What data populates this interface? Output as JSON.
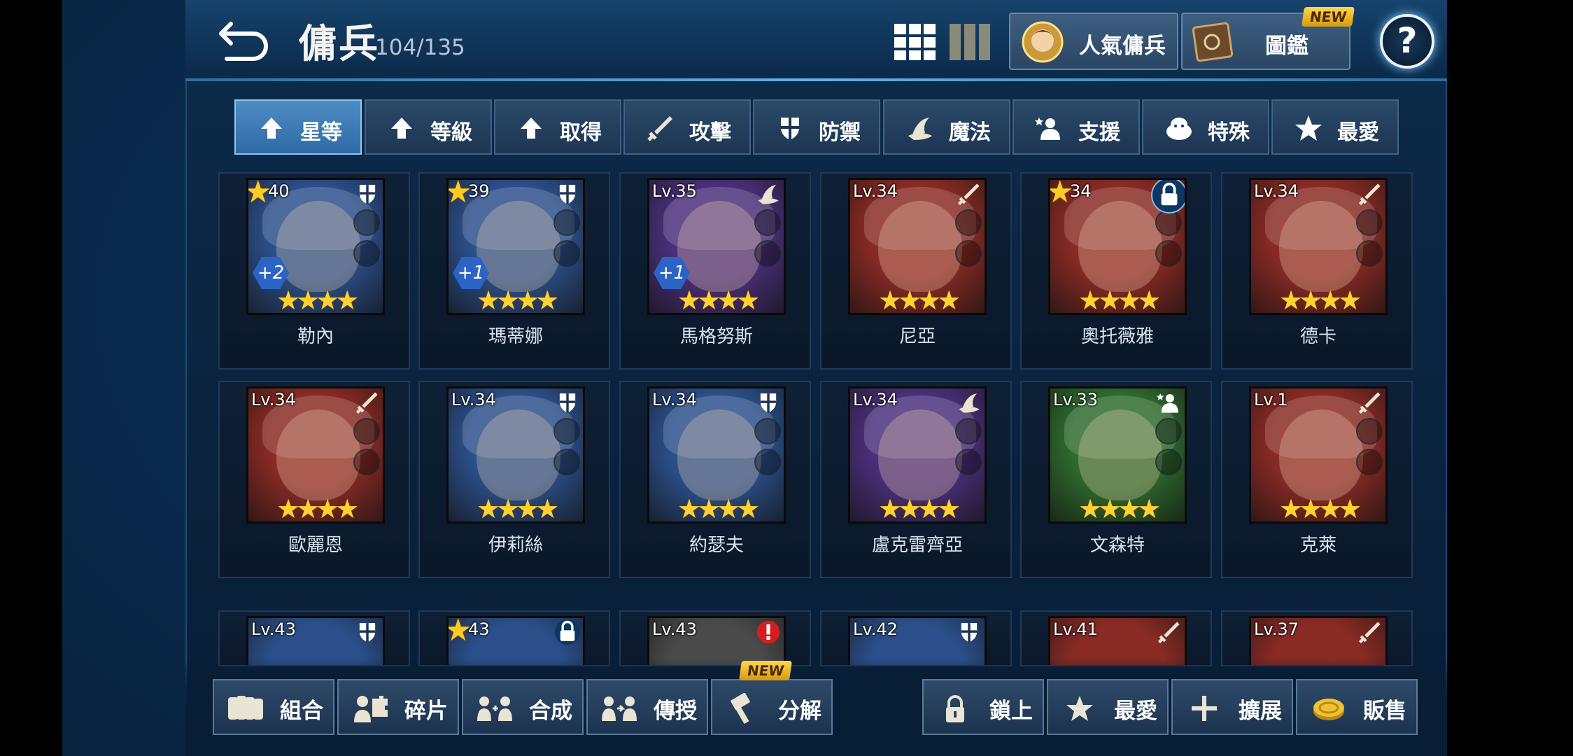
{
  "header": {
    "title": "傭兵",
    "count": "104/135",
    "popular_label": "人氣傭兵",
    "codex_label": "圖鑑",
    "codex_badge": "NEW",
    "help_glyph": "?"
  },
  "sort_tabs": [
    {
      "label": "星等",
      "icon": "up-arrow-icon",
      "active": true
    },
    {
      "label": "等級",
      "icon": "up-arrow-icon"
    },
    {
      "label": "取得",
      "icon": "up-arrow-icon"
    },
    {
      "label": "攻擊",
      "icon": "sword-icon"
    },
    {
      "label": "防禦",
      "icon": "shield-icon"
    },
    {
      "label": "魔法",
      "icon": "wizard-hat-icon"
    },
    {
      "label": "支援",
      "icon": "support-icon"
    },
    {
      "label": "特殊",
      "icon": "special-icon"
    },
    {
      "label": "最愛",
      "icon": "star-icon"
    }
  ],
  "mercenaries": [
    {
      "name": "勒內",
      "level": "40",
      "starred": true,
      "class": "shield-icon",
      "plus": "+2",
      "stars": "★★★★",
      "color": "#2b4f8a"
    },
    {
      "name": "瑪蒂娜",
      "level": "39",
      "starred": true,
      "class": "shield-icon",
      "plus": "+1",
      "stars": "★★★★",
      "color": "#2b4f8a"
    },
    {
      "name": "馬格努斯",
      "level": "Lv.35",
      "starred": false,
      "class": "wizard-hat-icon",
      "plus": "+1",
      "stars": "★★★★",
      "color": "#4a2f7a"
    },
    {
      "name": "尼亞",
      "level": "Lv.34",
      "starred": false,
      "class": "sword-icon",
      "plus": "",
      "stars": "★★★★",
      "color": "#8a2a24"
    },
    {
      "name": "奧托薇雅",
      "level": "34",
      "starred": true,
      "class": "sword-icon",
      "plus": "",
      "stars": "★★★★",
      "color": "#8a2a24",
      "locked": true
    },
    {
      "name": "德卡",
      "level": "Lv.34",
      "starred": false,
      "class": "sword-icon",
      "plus": "",
      "stars": "★★★★",
      "color": "#8a2a24"
    },
    {
      "name": "歐麗恩",
      "level": "Lv.34",
      "starred": false,
      "class": "sword-icon",
      "plus": "",
      "stars": "★★★★",
      "color": "#8a2a24"
    },
    {
      "name": "伊莉絲",
      "level": "Lv.34",
      "starred": false,
      "class": "shield-icon",
      "plus": "",
      "stars": "★★★★",
      "color": "#2b4f8a"
    },
    {
      "name": "約瑟夫",
      "level": "Lv.34",
      "starred": false,
      "class": "shield-icon",
      "plus": "",
      "stars": "★★★★",
      "color": "#2b4f8a"
    },
    {
      "name": "盧克雷齊亞",
      "level": "Lv.34",
      "starred": false,
      "class": "wizard-hat-icon",
      "plus": "",
      "stars": "★★★★",
      "color": "#4a2f7a"
    },
    {
      "name": "文森特",
      "level": "Lv.33",
      "starred": false,
      "class": "support-icon",
      "plus": "",
      "stars": "★★★★",
      "color": "#2e6a2e"
    },
    {
      "name": "克萊",
      "level": "Lv.1",
      "starred": false,
      "class": "sword-icon",
      "plus": "",
      "stars": "★★★★",
      "color": "#8a2a24"
    }
  ],
  "partial_row": [
    {
      "level": "Lv.43",
      "starred": false,
      "class": "shield-icon",
      "color": "#2b4f8a"
    },
    {
      "level": "43",
      "starred": true,
      "class": "lock-icon",
      "color": "#2b4f8a"
    },
    {
      "level": "Lv.43",
      "starred": false,
      "class": "alert-icon",
      "color": "#4a4a4a"
    },
    {
      "level": "Lv.42",
      "starred": false,
      "class": "shield-icon",
      "color": "#2b4f8a"
    },
    {
      "level": "Lv.41",
      "starred": false,
      "class": "sword-icon",
      "color": "#8a2a24"
    },
    {
      "level": "Lv.37",
      "starred": false,
      "class": "sword-icon",
      "color": "#8a2a24"
    }
  ],
  "bottom_actions": {
    "combine": "組合",
    "fragments": "碎片",
    "synthesize": "合成",
    "transfer": "傳授",
    "disassemble": "分解",
    "disassemble_badge": "NEW",
    "lock": "鎖上",
    "favorite": "最愛",
    "expand": "擴展",
    "sell": "販售"
  }
}
